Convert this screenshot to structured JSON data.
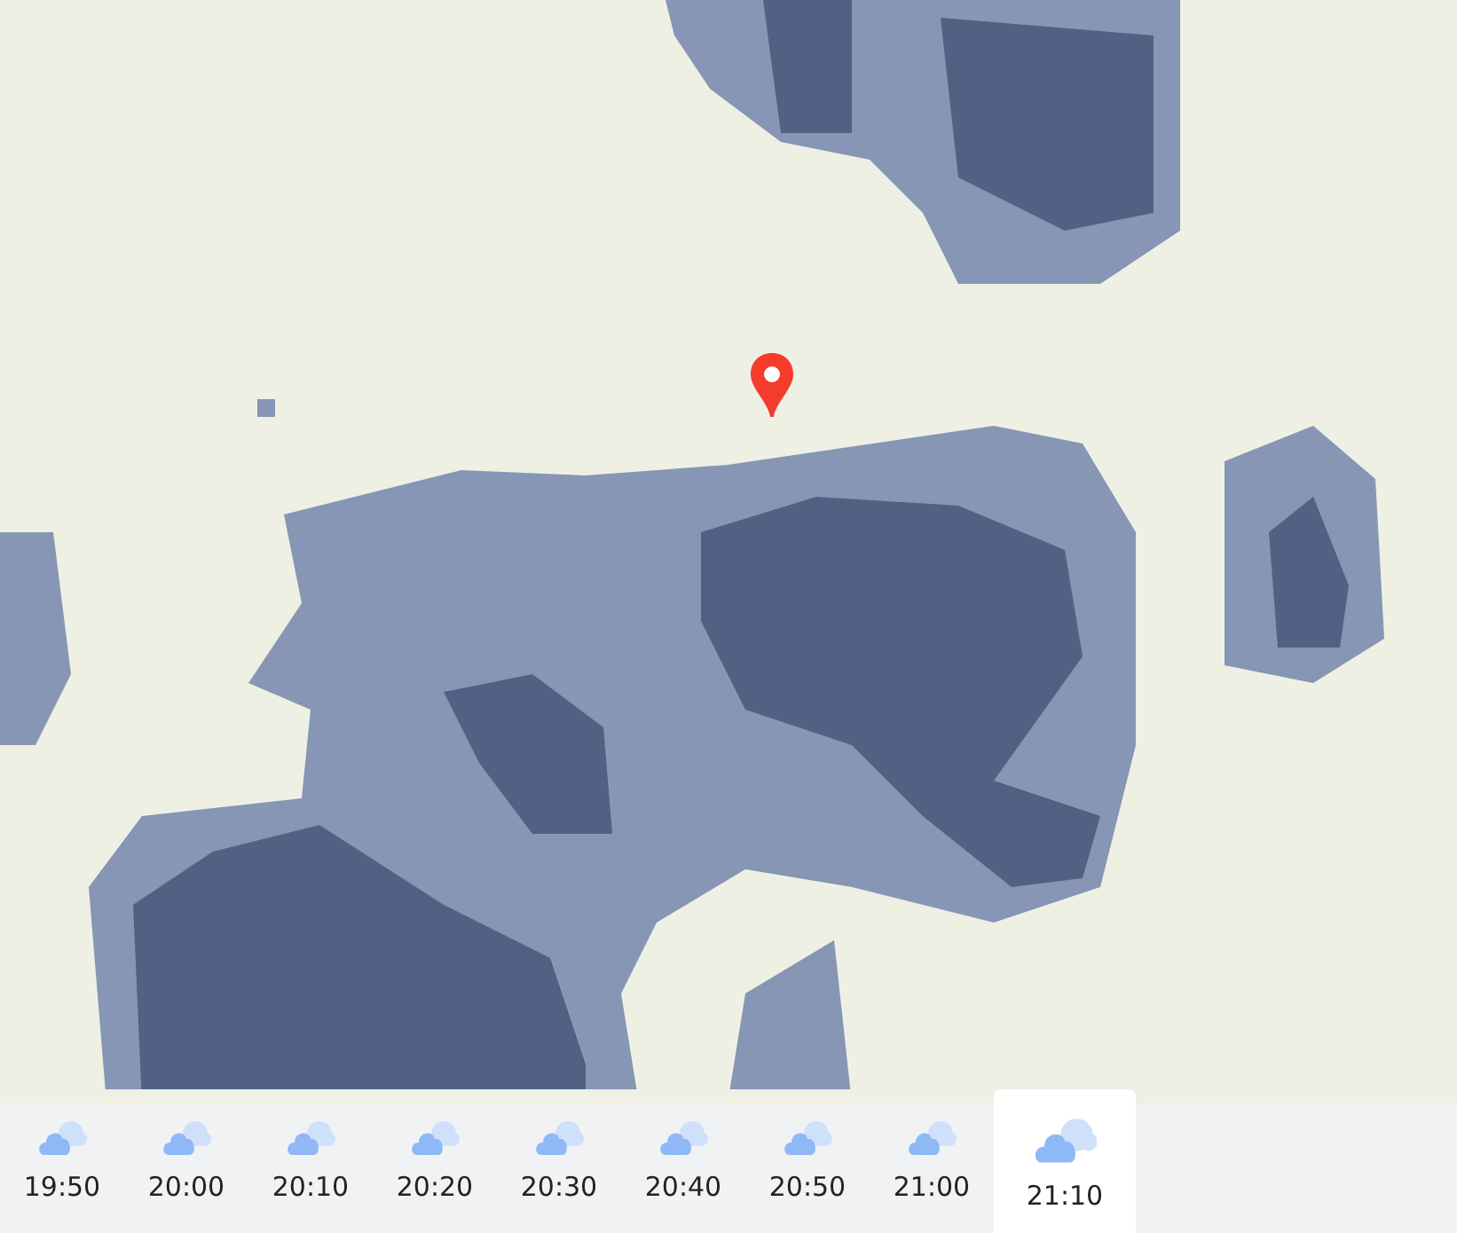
{
  "timeline": [
    {
      "time": "19:50",
      "selected": false
    },
    {
      "time": "20:00",
      "selected": false
    },
    {
      "time": "20:10",
      "selected": false
    },
    {
      "time": "20:20",
      "selected": false
    },
    {
      "time": "20:30",
      "selected": false
    },
    {
      "time": "20:40",
      "selected": false
    },
    {
      "time": "20:50",
      "selected": false
    },
    {
      "time": "21:00",
      "selected": false
    },
    {
      "time": "21:10",
      "selected": true
    }
  ]
}
